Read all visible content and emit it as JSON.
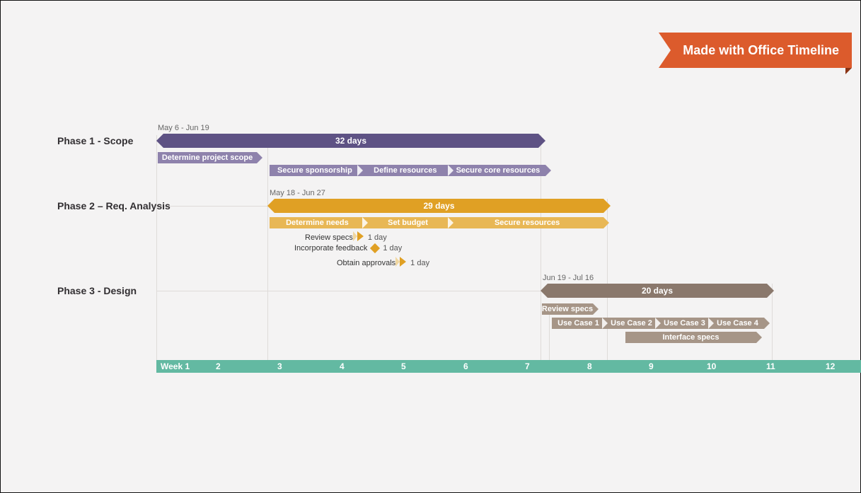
{
  "ribbon": "Made with Office Timeline",
  "phases": [
    {
      "name": "Phase 1 - Scope",
      "range": "May 6 - Jun 19",
      "duration": "32 days"
    },
    {
      "name": "Phase 2 – Req. Analysis",
      "range": "May 18 - Jun 27",
      "duration": "29 days"
    },
    {
      "name": "Phase 3 - Design",
      "range": "Jun 19 - Jul 16",
      "duration": "20 days"
    }
  ],
  "p1": {
    "t0": "Determine project scope",
    "t1": "Secure sponsorship",
    "t2": "Define resources",
    "t3": "Secure core resources"
  },
  "p2": {
    "t0": "Determine needs",
    "t1": "Set budget",
    "t2": "Secure resources",
    "m0": {
      "label": "Review specs",
      "dur": "1 day"
    },
    "m1": {
      "label": "Incorporate feedback",
      "dur": "1 day"
    },
    "m2": {
      "label": "Obtain approvals",
      "dur": "1 day"
    }
  },
  "p3": {
    "t0": "Review specs",
    "t1": "Use Case 1",
    "t2": "Use Case 2",
    "t3": "Use Case 3",
    "t4": "Use Case 4",
    "t5": "Interface specs"
  },
  "weeks": {
    "first": "Week 1",
    "nums": [
      "2",
      "3",
      "4",
      "5",
      "6",
      "7",
      "8",
      "9",
      "10",
      "11",
      "12"
    ]
  },
  "chart_data": {
    "type": "gantt",
    "title": "Project timeline (weeks)",
    "x_unit": "week",
    "xlim": [
      1,
      12
    ],
    "swimlanes": [
      {
        "name": "Phase 1 - Scope",
        "date_range": "May 6 - Jun 19",
        "duration_days": 32,
        "start_week": 1,
        "end_week": 8,
        "tasks": [
          {
            "name": "Determine project scope",
            "start_week": 1,
            "end_week": 2.7
          },
          {
            "name": "Secure sponsorship",
            "start_week": 3.2,
            "end_week": 4.7
          },
          {
            "name": "Define resources",
            "start_week": 4.7,
            "end_week": 6.2
          },
          {
            "name": "Secure core resources",
            "start_week": 6.2,
            "end_week": 8.0
          }
        ]
      },
      {
        "name": "Phase 2 – Req. Analysis",
        "date_range": "May 18 - Jun 27",
        "duration_days": 29,
        "start_week": 3.3,
        "end_week": 9.0,
        "tasks": [
          {
            "name": "Determine needs",
            "start_week": 3.4,
            "end_week": 4.9
          },
          {
            "name": "Set budget",
            "start_week": 4.9,
            "end_week": 6.3
          },
          {
            "name": "Secure resources",
            "start_week": 6.3,
            "end_week": 9.0
          }
        ],
        "milestones": [
          {
            "name": "Review specs",
            "at_week": 4.8,
            "duration": "1 day"
          },
          {
            "name": "Incorporate feedback",
            "at_week": 5.0,
            "duration": "1 day"
          },
          {
            "name": "Obtain approvals",
            "at_week": 5.5,
            "duration": "1 day"
          }
        ]
      },
      {
        "name": "Phase 3 - Design",
        "date_range": "Jun 19 - Jul 16",
        "duration_days": 20,
        "start_week": 8.0,
        "end_week": 12.0,
        "tasks": [
          {
            "name": "Review specs",
            "start_week": 8.0,
            "end_week": 8.8
          },
          {
            "name": "Use Case 1",
            "start_week": 8.2,
            "end_week": 9.1
          },
          {
            "name": "Use Case 2",
            "start_week": 9.1,
            "end_week": 10.0
          },
          {
            "name": "Use Case 3",
            "start_week": 10.0,
            "end_week": 10.9
          },
          {
            "name": "Use Case 4",
            "start_week": 10.9,
            "end_week": 11.8
          },
          {
            "name": "Interface specs",
            "start_week": 9.5,
            "end_week": 11.7
          }
        ]
      }
    ]
  }
}
